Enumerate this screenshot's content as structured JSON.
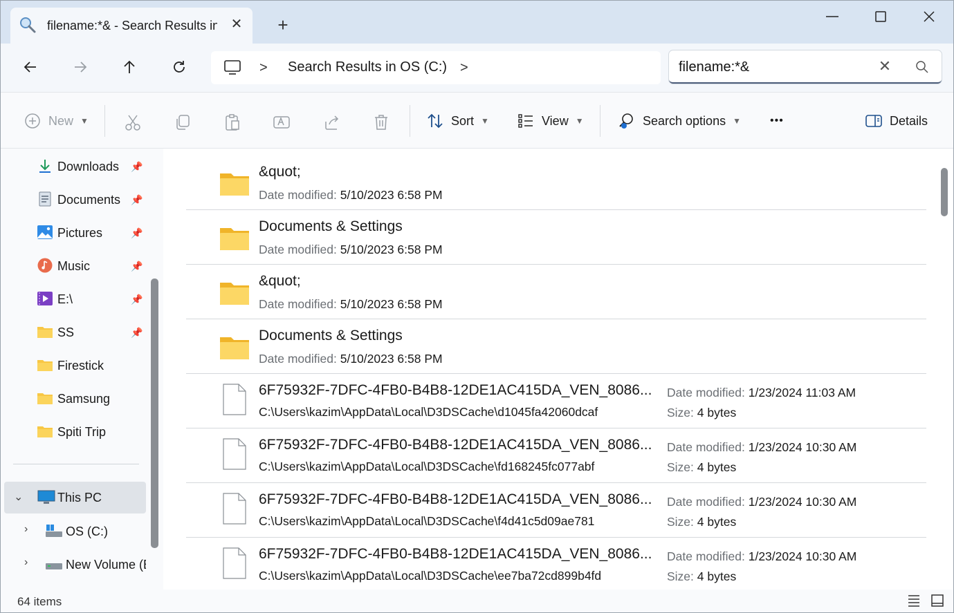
{
  "tab": {
    "title": "filename:*& - Search Results in OS (C:)",
    "close": "✕",
    "new_tab": "+"
  },
  "window": {
    "minimize": "—",
    "maximize": "☐",
    "close": "✕"
  },
  "nav": {
    "breadcrumb_chevron": ">",
    "breadcrumb": "Search Results in OS (C:)",
    "breadcrumb_end_chevron": ">"
  },
  "search": {
    "value": "filename:*&",
    "clear": "✕"
  },
  "commands": {
    "new": "New",
    "sort": "Sort",
    "view": "View",
    "search_options": "Search options",
    "more": "•••",
    "details": "Details"
  },
  "sidebar": {
    "items": [
      {
        "label": "Downloads",
        "icon": "download-icon",
        "pinned": true
      },
      {
        "label": "Documents",
        "icon": "documents-icon",
        "pinned": true
      },
      {
        "label": "Pictures",
        "icon": "pictures-icon",
        "pinned": true
      },
      {
        "label": "Music",
        "icon": "music-icon",
        "pinned": true
      },
      {
        "label": "E:\\",
        "icon": "video-icon",
        "pinned": true
      },
      {
        "label": "SS",
        "icon": "folder-icon",
        "pinned": true
      },
      {
        "label": "Firestick",
        "icon": "folder-icon",
        "pinned": false
      },
      {
        "label": "Samsung",
        "icon": "folder-icon",
        "pinned": false
      },
      {
        "label": "Spiti Trip",
        "icon": "folder-icon",
        "pinned": false
      }
    ],
    "this_pc": "This PC",
    "drives": [
      {
        "label": "OS (C:)"
      },
      {
        "label": "New Volume (E"
      }
    ]
  },
  "results": {
    "date_label": "Date modified:",
    "size_label": "Size:",
    "folders": [
      {
        "name": "&quot;",
        "date": "5/10/2023 6:58 PM"
      },
      {
        "name": "Documents & Settings",
        "date": "5/10/2023 6:58 PM"
      },
      {
        "name": "&quot;",
        "date": "5/10/2023 6:58 PM"
      },
      {
        "name": "Documents & Settings",
        "date": "5/10/2023 6:58 PM"
      }
    ],
    "files": [
      {
        "name": "6F75932F-7DFC-4FB0-B4B8-12DE1AC415DA_VEN_8086...",
        "path": "C:\\Users\\kazim\\AppData\\Local\\D3DSCache\\d1045fa42060dcaf",
        "date": "1/23/2024 11:03 AM",
        "size": "4 bytes"
      },
      {
        "name": "6F75932F-7DFC-4FB0-B4B8-12DE1AC415DA_VEN_8086...",
        "path": "C:\\Users\\kazim\\AppData\\Local\\D3DSCache\\fd168245fc077abf",
        "date": "1/23/2024 10:30 AM",
        "size": "4 bytes"
      },
      {
        "name": "6F75932F-7DFC-4FB0-B4B8-12DE1AC415DA_VEN_8086...",
        "path": "C:\\Users\\kazim\\AppData\\Local\\D3DSCache\\f4d41c5d09ae781",
        "date": "1/23/2024 10:30 AM",
        "size": "4 bytes"
      },
      {
        "name": "6F75932F-7DFC-4FB0-B4B8-12DE1AC415DA_VEN_8086...",
        "path": "C:\\Users\\kazim\\AppData\\Local\\D3DSCache\\ee7ba72cd899b4fd",
        "date": "1/23/2024 10:30 AM",
        "size": "4 bytes"
      }
    ]
  },
  "status": {
    "count": "64 items"
  },
  "colors": {
    "accent": "#0067c0",
    "folder": "#f8c745",
    "selected": "#dfe3e8"
  }
}
